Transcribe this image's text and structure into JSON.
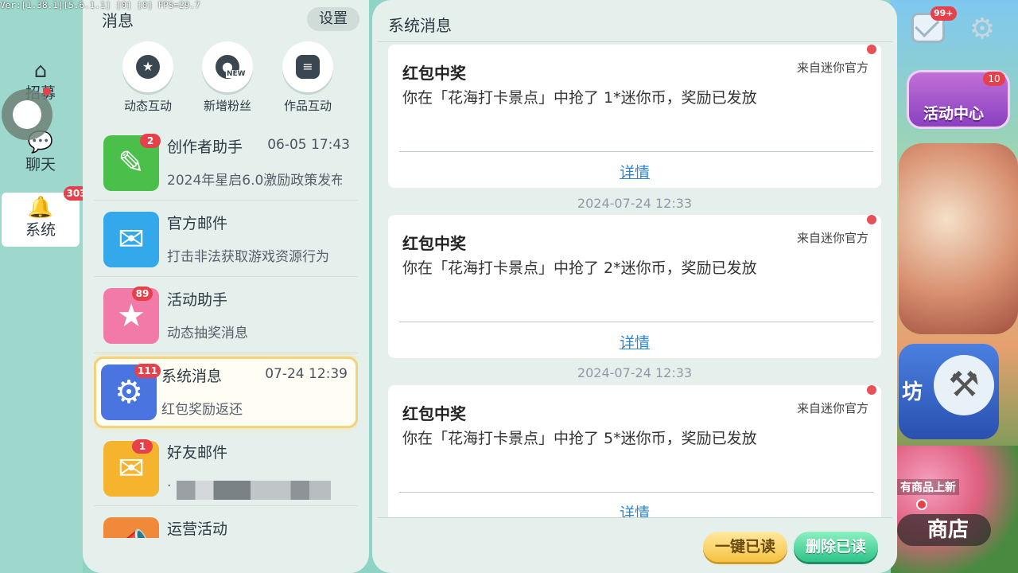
{
  "debug_text": "Ver:[1.38.1][5.6.1.1] [0] [0] FPS=29.7",
  "game": {
    "mail_badge": "99+",
    "activity_center": {
      "label": "活动中心",
      "badge": "10"
    },
    "tool_label": "坊",
    "new_goods": "有商品上新",
    "shop_label": "商店"
  },
  "nav": {
    "items": [
      {
        "label": "招募",
        "icon": "home-icon"
      },
      {
        "label": "聊天",
        "icon": "chat-icon"
      },
      {
        "label": "系统",
        "icon": "bell-icon",
        "badge": "303"
      }
    ]
  },
  "messages": {
    "title": "消息",
    "settings": "设置",
    "quick": [
      {
        "label": "动态互动",
        "icon": "star-chat-icon"
      },
      {
        "label": "新增粉丝",
        "icon": "new-fan-icon",
        "tag": "NEW"
      },
      {
        "label": "作品互动",
        "icon": "list-icon"
      }
    ],
    "conversations": [
      {
        "name": "创作者助手",
        "time": "06-05 17:43",
        "preview": "2024年星启6.0激励政策发布",
        "badge": "2",
        "color": "#4ac04a",
        "icon": "pen-ruler-icon"
      },
      {
        "name": "官方邮件",
        "time": "",
        "preview": "打击非法获取游戏资源行为",
        "badge": "",
        "color": "#33a8ea",
        "icon": "mail-icon"
      },
      {
        "name": "活动助手",
        "time": "",
        "preview": "动态抽奖消息",
        "badge": "89",
        "color": "#f27aa8",
        "icon": "bookmark-star-icon"
      },
      {
        "name": "系统消息",
        "time": "07-24 12:39",
        "preview": "红包奖励返还",
        "badge": "111",
        "color": "#4a74e0",
        "icon": "gear-icon"
      },
      {
        "name": "好友邮件",
        "time": "",
        "preview": ".",
        "badge": "1",
        "color": "#f6b42e",
        "icon": "friend-mail-icon"
      },
      {
        "name": "运营活动",
        "time": "",
        "preview": "",
        "badge": "",
        "color": "#f08a3a",
        "icon": "megaphone-icon"
      }
    ]
  },
  "detail": {
    "title": "系统消息",
    "cards": [
      {
        "title": "红包中奖",
        "from": "来自迷你官方",
        "body": "你在「花海打卡景点」中抢了 1*迷你币，奖励已发放",
        "link": "详情"
      },
      {
        "title": "红包中奖",
        "from": "来自迷你官方",
        "body": "你在「花海打卡景点」中抢了 2*迷你币，奖励已发放",
        "link": "详情"
      },
      {
        "title": "红包中奖",
        "from": "来自迷你官方",
        "body": "你在「花海打卡景点」中抢了 5*迷你币，奖励已发放",
        "link": "详情"
      }
    ],
    "timestamps": [
      "2024-07-24 12:33",
      "2024-07-24 12:33"
    ],
    "read_all": "一键已读",
    "delete_read": "删除已读"
  }
}
